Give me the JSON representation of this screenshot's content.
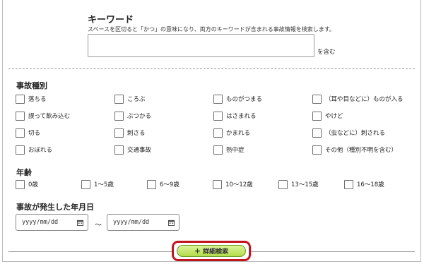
{
  "keyword": {
    "title": "キーワード",
    "description": "スペースを区切ると「かつ」の意味になり、両方のキーワードが含まれる事故情報を検索します。",
    "value": "",
    "suffix": "を含む"
  },
  "accident_type": {
    "title": "事故種別",
    "items": [
      {
        "label": "落ちる",
        "checked": false
      },
      {
        "label": "ころぶ",
        "checked": false
      },
      {
        "label": "ものがつまる",
        "checked": false
      },
      {
        "label": "（耳や目などに）ものが入る",
        "checked": false
      },
      {
        "label": "誤って飲み込む",
        "checked": false
      },
      {
        "label": "ぶつかる",
        "checked": false
      },
      {
        "label": "はさまれる",
        "checked": false
      },
      {
        "label": "やけど",
        "checked": false
      },
      {
        "label": "切る",
        "checked": false
      },
      {
        "label": "刺さる",
        "checked": false
      },
      {
        "label": "かまれる",
        "checked": false
      },
      {
        "label": "（虫などに）刺される",
        "checked": false
      },
      {
        "label": "おぼれる",
        "checked": false
      },
      {
        "label": "交通事故",
        "checked": false
      },
      {
        "label": "熱中症",
        "checked": false
      },
      {
        "label": "その他（種別不明を含む）",
        "checked": false
      }
    ]
  },
  "age": {
    "title": "年齢",
    "items": [
      {
        "label": "0歳",
        "checked": false
      },
      {
        "label": "1～5歳",
        "checked": false
      },
      {
        "label": "6～9歳",
        "checked": false
      },
      {
        "label": "10～12歳",
        "checked": false
      },
      {
        "label": "13～15歳",
        "checked": false
      },
      {
        "label": "16～18歳",
        "checked": false
      }
    ]
  },
  "date": {
    "title": "事故が発生した年月日",
    "from_placeholder": "yyyy/mm/dd",
    "to_placeholder": "yyyy/mm/dd",
    "separator": "～"
  },
  "detail_search": {
    "label": "詳細検索",
    "icon": "plus-icon"
  },
  "colors": {
    "button_green": "#b3dc4c",
    "highlight_red": "#c0141e"
  }
}
